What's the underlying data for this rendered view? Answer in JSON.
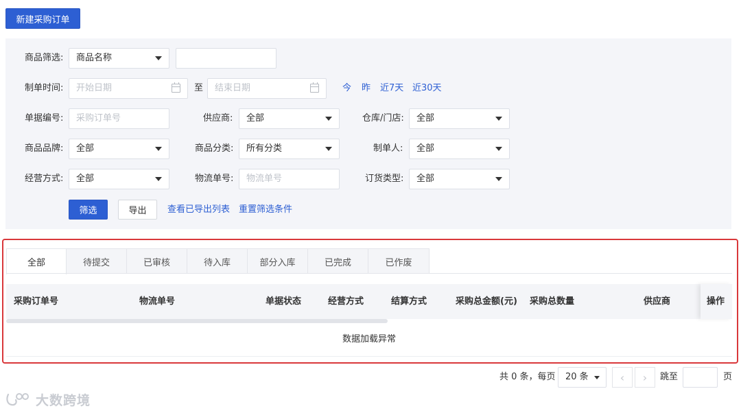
{
  "header": {
    "new_order_button": "新建采购订单"
  },
  "filters": {
    "product_filter_label": "商品筛选:",
    "product_filter_select": "商品名称",
    "product_filter_value": "",
    "order_time_label": "制单时间:",
    "start_date_placeholder": "开始日期",
    "to_label": "至",
    "end_date_placeholder": "结束日期",
    "quick_dates": [
      "今",
      "昨",
      "近7天",
      "近30天"
    ],
    "doc_no_label": "单据编号:",
    "doc_no_placeholder": "采购订单号",
    "supplier_label": "供应商:",
    "supplier_value": "全部",
    "warehouse_label": "仓库/门店:",
    "warehouse_value": "全部",
    "brand_label": "商品品牌:",
    "brand_value": "全部",
    "category_label": "商品分类:",
    "category_value": "所有分类",
    "creator_label": "制单人:",
    "creator_value": "全部",
    "operation_mode_label": "经营方式:",
    "operation_mode_value": "全部",
    "logistics_no_label": "物流单号:",
    "logistics_no_placeholder": "物流单号",
    "order_type_label": "订货类型:",
    "order_type_value": "全部",
    "filter_button": "筛选",
    "export_button": "导出",
    "view_exports_link": "查看已导出列表",
    "reset_link": "重置筛选条件"
  },
  "tabs": [
    "全部",
    "待提交",
    "已审核",
    "待入库",
    "部分入库",
    "已完成",
    "已作废"
  ],
  "active_tab": "全部",
  "table": {
    "columns": [
      "采购订单号",
      "物流单号",
      "单据状态",
      "经营方式",
      "结算方式",
      "采购总金额(元)",
      "采购总数量",
      "供应商",
      "操作"
    ],
    "empty_message": "数据加载异常"
  },
  "pagination": {
    "total_text": "共 0 条，每页",
    "page_size": "20 条",
    "jump_label": "跳至",
    "jump_value": "",
    "page_unit": "页"
  },
  "watermark": {
    "text": "大数跨境"
  },
  "colors": {
    "primary": "#2d5fd3",
    "highlight_border": "#d9373a",
    "panel_bg": "#f4f5f9"
  }
}
